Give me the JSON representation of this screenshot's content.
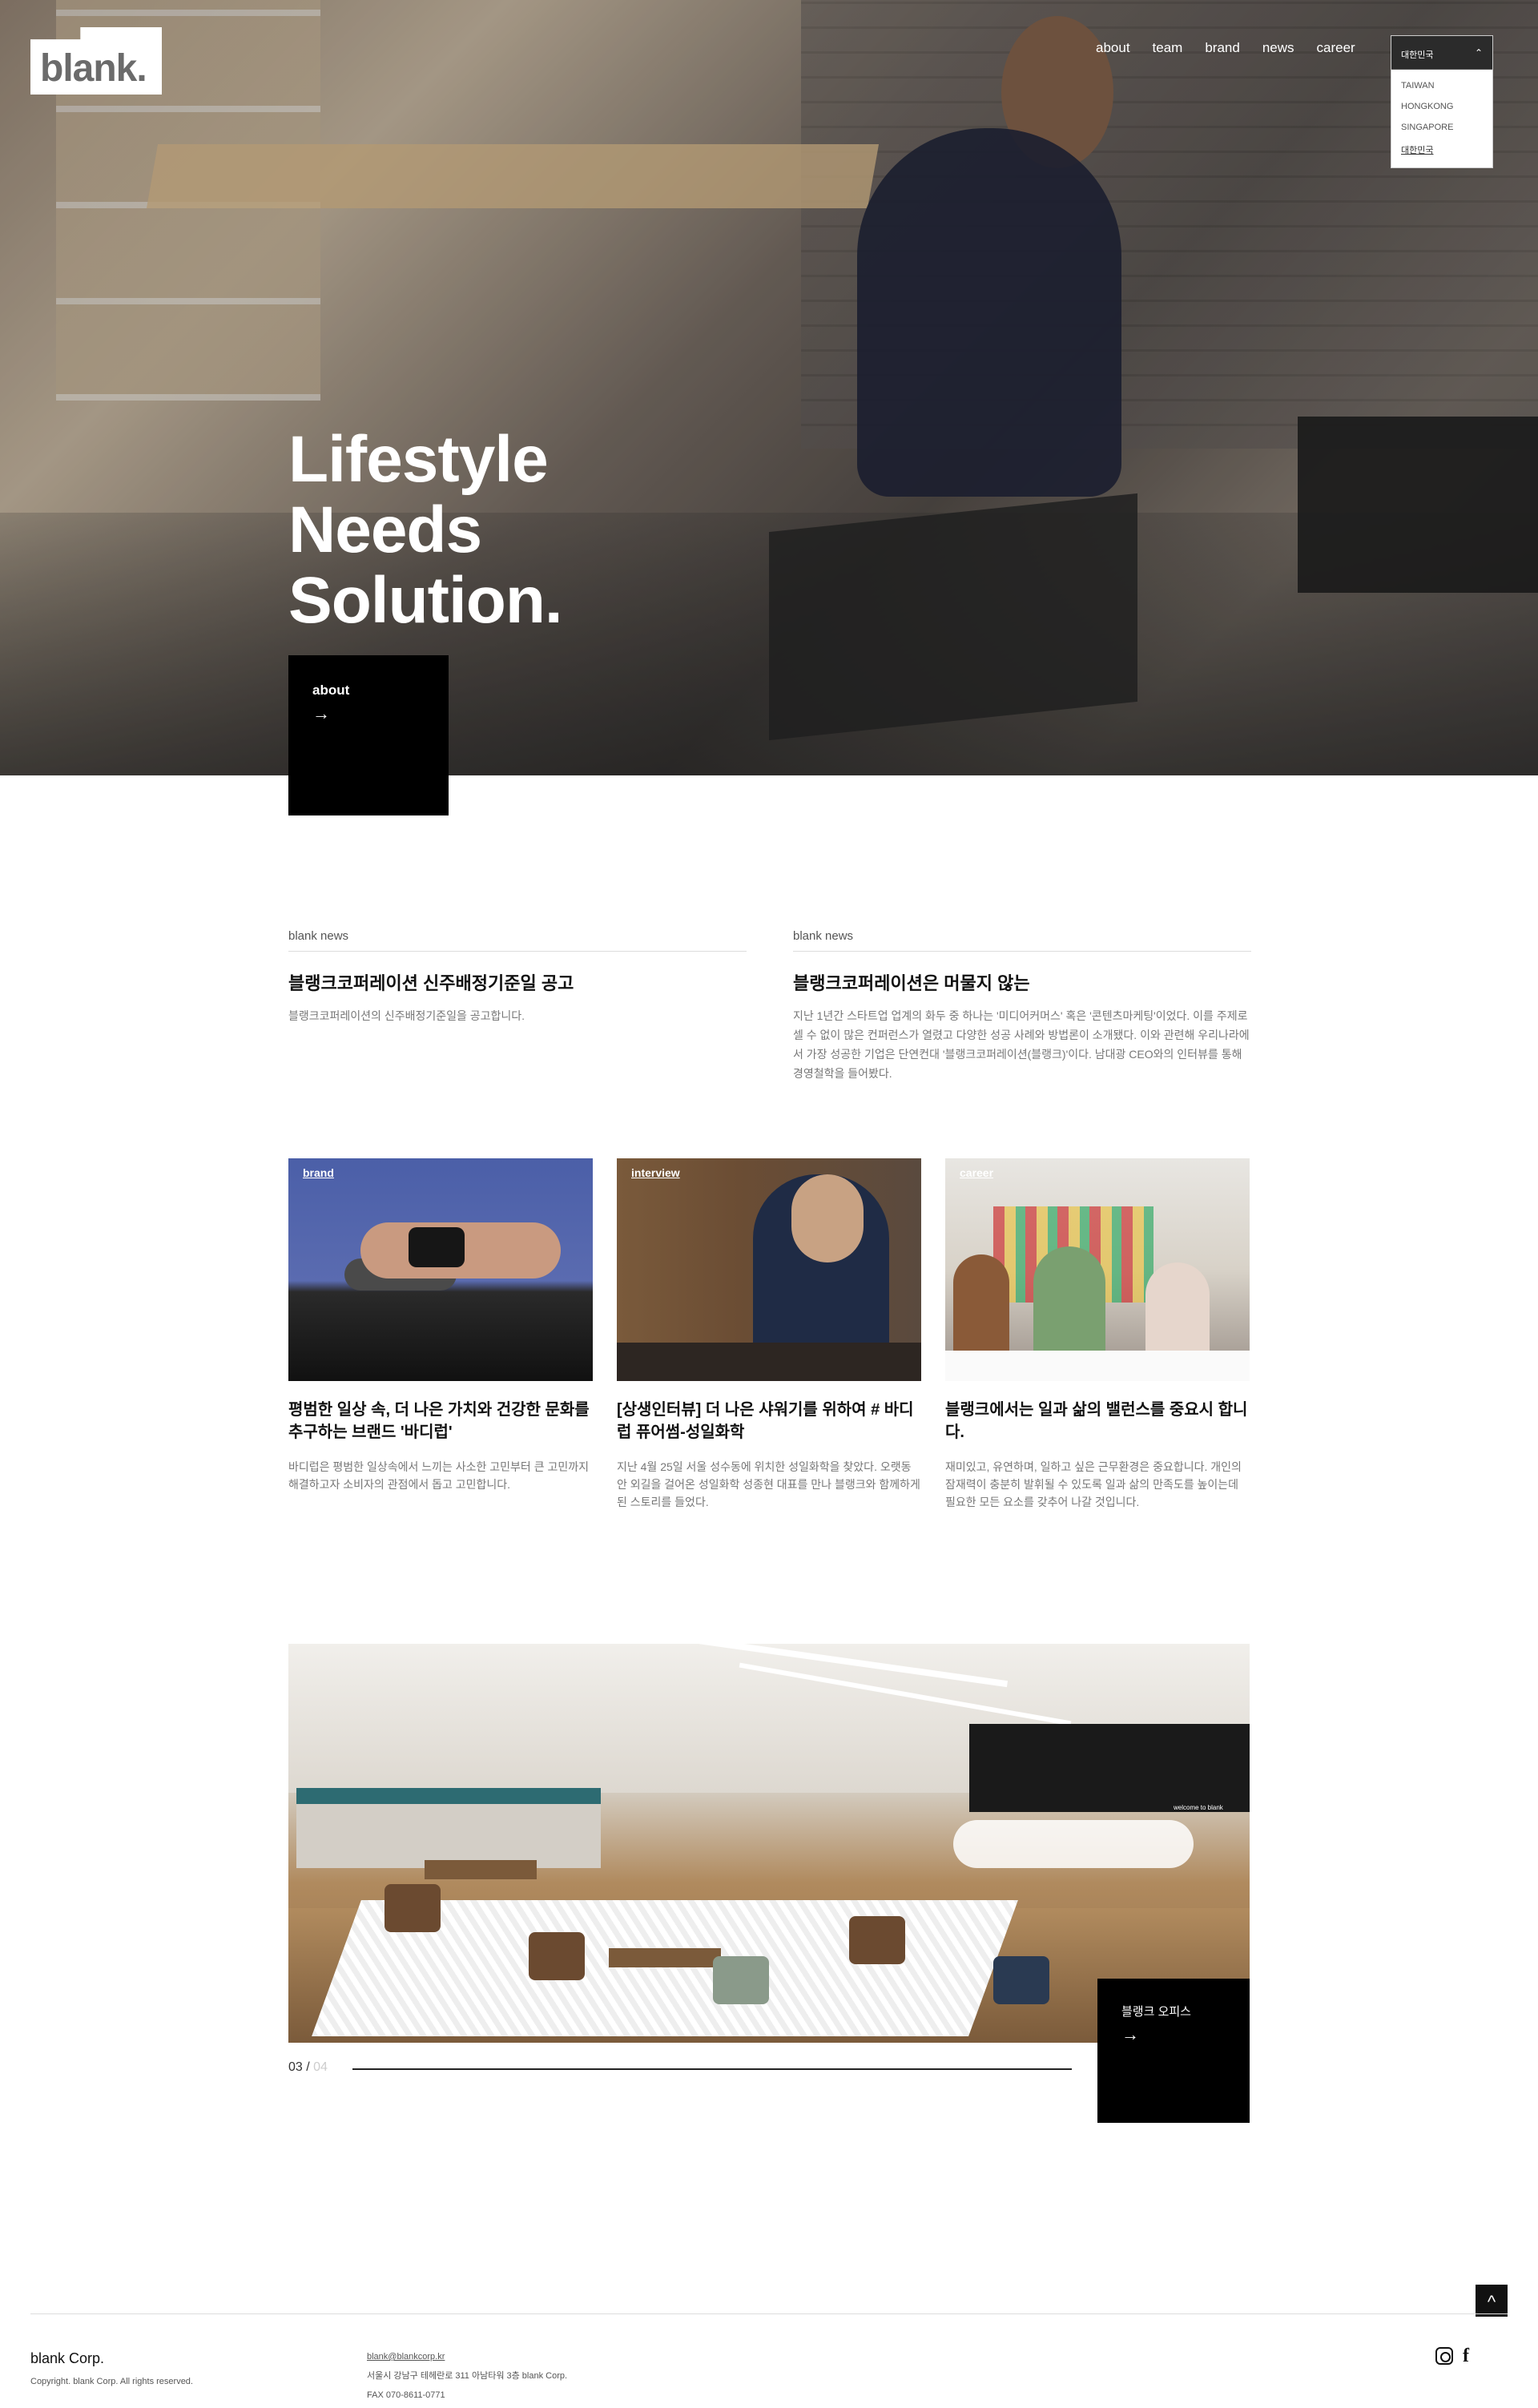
{
  "header": {
    "logo": "blank.",
    "nav": [
      "about",
      "team",
      "brand",
      "news",
      "career"
    ],
    "lang": {
      "selected": "대한민국",
      "options": [
        "TAIWAN",
        "HONGKONG",
        "SINGAPORE",
        "대한민국"
      ]
    }
  },
  "hero": {
    "title_lines": [
      "Lifestyle",
      "Needs",
      "Solution."
    ],
    "button_label": "about",
    "arrow": "→"
  },
  "news": [
    {
      "category": "blank news",
      "title": "블랭크코퍼레이션 신주배정기준일 공고",
      "desc": "블랭크코퍼레이션의 신주배정기준일을 공고합니다."
    },
    {
      "category": "blank news",
      "title": "블랭크코퍼레이션은 머물지 않는",
      "desc": "지난 1년간 스타트업 업계의 화두 중 하나는 '미디어커머스' 혹은 '콘텐츠마케팅'이었다. 이를 주제로 셀 수 없이 많은 컨퍼런스가 열렸고 다양한 성공 사례와 방법론이 소개됐다. 이와 관련해 우리나라에서 가장 성공한 기업은 단연컨대 '블랭크코퍼레이션(블랭크)'이다. 남대광 CEO와의 인터뷰를 통해 경영철학을 들어봤다."
    }
  ],
  "cards": [
    {
      "tag": "brand",
      "title": "평범한 일상 속, 더 나은 가치와 건강한 문화를 추구하는 브랜드 '바디럽'",
      "desc": "바디럽은 평범한 일상속에서 느끼는 사소한 고민부터 큰 고민까지 해결하고자 소비자의 관점에서 돕고 고민합니다."
    },
    {
      "tag": "interview",
      "title": "[상생인터뷰] 더 나은 샤워기를 위하여 # 바디럽 퓨어썸-성일화학",
      "desc": "지난 4월 25일 서울 성수동에 위치한 성일화학을 찾았다. 오랫동안 외길을 걸어온 성일화학 성종현 대표를 만나 블랭크와 함께하게 된 스토리를 들었다."
    },
    {
      "tag": "career",
      "title": "블랭크에서는 일과 삶의 밸런스를 중요시 합니다.",
      "desc": "재미있고, 유연하며, 일하고 싶은 근무환경은 중요합니다. 개인의 잠재력이 충분히 발휘될 수 있도록 일과 삶의 만족도를 높이는데 필요한 모든 요소를 갖추어 나갈 것입니다."
    }
  ],
  "office": {
    "label": "블랭크 오피스",
    "arrow": "→",
    "welcome": "welcome to blank",
    "current": "03",
    "separator": "/",
    "total": "04"
  },
  "footer": {
    "corp": "blank Corp.",
    "copyright": "Copyright. blank Corp. All rights reserved.",
    "email": "blank@blankcorp.kr",
    "address": "서울시 강남구 테헤란로 311 아남타워 3층 blank Corp.",
    "fax": "FAX 070-8611-0771",
    "top_icon": "^"
  }
}
